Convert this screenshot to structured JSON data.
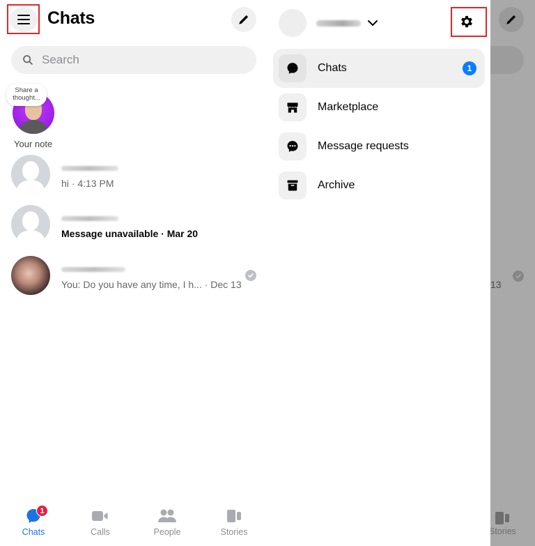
{
  "left_panel": {
    "header": {
      "title": "Chats",
      "menu_icon": "hamburger-menu-icon",
      "compose_icon": "pencil-icon"
    },
    "search": {
      "placeholder": "Search",
      "value": "",
      "icon": "search-icon"
    },
    "note": {
      "bubble_text": "Share a thought...",
      "label": "Your note"
    },
    "chats": [
      {
        "name": "[blurred]",
        "preview": "hi · 4:13 PM",
        "unread": false,
        "avatar": "default-silhouette",
        "seen": false
      },
      {
        "name": "[blurred]",
        "preview": "Message unavailable · Mar 20",
        "unread": true,
        "avatar": "default-silhouette",
        "seen": false
      },
      {
        "name": "[blurred]",
        "preview": "You: Do you have any time, I h... · Dec 13",
        "unread": false,
        "avatar": "photo",
        "seen": true
      }
    ],
    "tabs": [
      {
        "label": "Chats",
        "icon": "chat-bubble-icon",
        "active": true,
        "badge": "1"
      },
      {
        "label": "Calls",
        "icon": "video-camera-icon",
        "active": false
      },
      {
        "label": "People",
        "icon": "people-icon",
        "active": false
      },
      {
        "label": "Stories",
        "icon": "stories-icon",
        "active": false
      }
    ]
  },
  "right_panel": {
    "account": {
      "name": "[blurred]",
      "chevron_icon": "chevron-down-icon",
      "settings_icon": "gear-icon"
    },
    "menu": [
      {
        "label": "Chats",
        "icon": "chat-bubble-icon",
        "active": true,
        "badge": "1"
      },
      {
        "label": "Marketplace",
        "icon": "storefront-icon",
        "active": false
      },
      {
        "label": "Message requests",
        "icon": "message-requests-icon",
        "active": false
      },
      {
        "label": "Archive",
        "icon": "archive-box-icon",
        "active": false
      }
    ],
    "overlay": {
      "date_fragment": "13",
      "tab_fragment": "Stories"
    }
  },
  "colors": {
    "accent_blue": "#1b74e4",
    "badge_blue": "#0a7cff",
    "badge_red": "#e41e3f",
    "highlight_red": "#e0262b",
    "overlay_gray": "#a9a9a9"
  }
}
